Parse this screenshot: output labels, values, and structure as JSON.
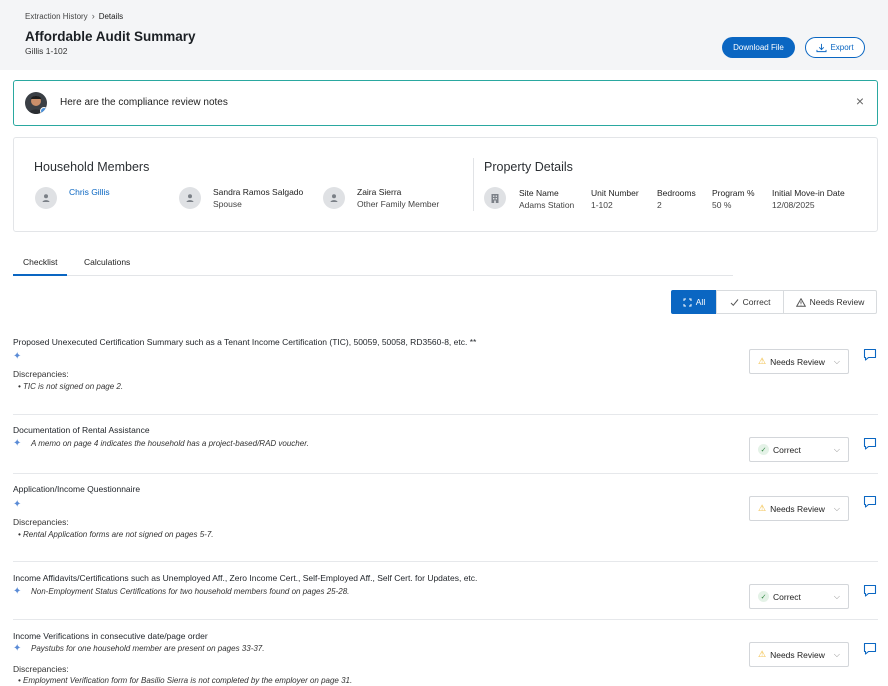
{
  "breadcrumb": {
    "parent": "Extraction History",
    "separator": "›",
    "current": "Details"
  },
  "header": {
    "title": "Affordable Audit Summary",
    "subtitle": "Gillis 1-102",
    "download_label": "Download File",
    "export_label": "Export"
  },
  "notes_banner": {
    "text": "Here are the compliance review notes",
    "close": "×"
  },
  "household": {
    "title": "Household Members",
    "members": [
      {
        "name": "Chris Gillis",
        "role": ""
      },
      {
        "name": "Sandra Ramos Salgado",
        "role": "Spouse"
      },
      {
        "name": "Zaira Sierra",
        "role": "Other Family Member"
      }
    ]
  },
  "property": {
    "title": "Property Details",
    "fields": [
      {
        "label": "Site Name",
        "value": "Adams Station"
      },
      {
        "label": "Unit Number",
        "value": "1-102"
      },
      {
        "label": "Bedrooms",
        "value": "2"
      },
      {
        "label": "Program %",
        "value": "50 %"
      },
      {
        "label": "Initial Move-in Date",
        "value": "12/08/2025"
      }
    ]
  },
  "tabs": [
    {
      "label": "Checklist",
      "active": true
    },
    {
      "label": "Calculations",
      "active": false
    }
  ],
  "filters": {
    "all": "All",
    "correct": "Correct",
    "needs_review": "Needs Review"
  },
  "checklist": [
    {
      "title": "Proposed Unexecuted Certification Summary such as a Tenant Income Certification (TIC), 50059, 50058, RD3560-8, etc. **",
      "ai_note": "",
      "discrepancies_label": "Discrepancies:",
      "discrepancies": [
        "TIC is not signed on page 2."
      ],
      "status": "Needs Review"
    },
    {
      "title": "Documentation of Rental Assistance",
      "ai_note": "A memo on page 4 indicates the household has a project-based/RAD voucher.",
      "discrepancies_label": "",
      "discrepancies": [],
      "status": "Correct"
    },
    {
      "title": "Application/Income Questionnaire",
      "ai_note": "",
      "discrepancies_label": "Discrepancies:",
      "discrepancies": [
        "Rental Application forms are not signed on pages 5-7."
      ],
      "status": "Needs Review"
    },
    {
      "title": "Income Affidavits/Certifications such as Unemployed Aff., Zero Income Cert., Self-Employed Aff., Self Cert. for Updates, etc.",
      "ai_note": "Non-Employment Status Certifications for two household members found on pages 25-28.",
      "discrepancies_label": "",
      "discrepancies": [],
      "status": "Correct"
    },
    {
      "title": "Income Verifications in consecutive date/page order",
      "ai_note": "Paystubs for one household member are present on pages 33-37.",
      "discrepancies_label": "Discrepancies:",
      "discrepancies": [
        "Employment Verification form for Basilio Sierra is not completed by the employer on page 31."
      ],
      "status": "Needs Review"
    }
  ]
}
